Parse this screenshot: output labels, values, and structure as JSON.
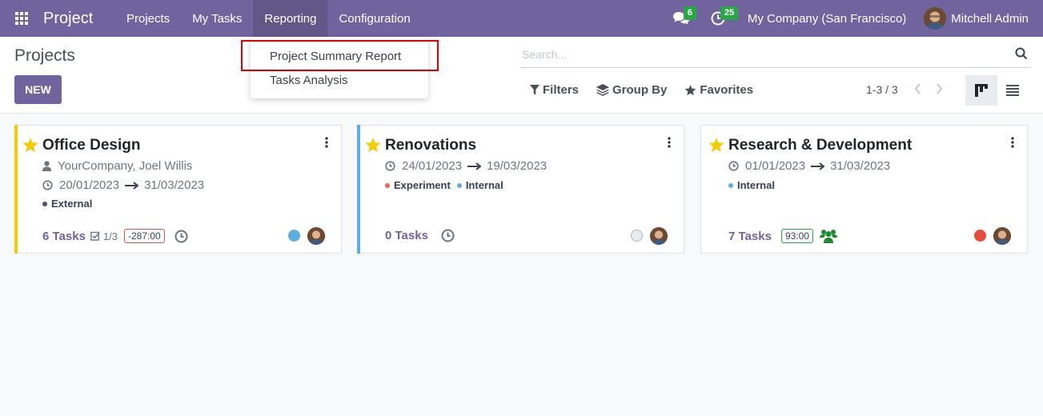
{
  "navbar": {
    "app_name": "Project",
    "menu": [
      "Projects",
      "My Tasks",
      "Reporting",
      "Configuration"
    ],
    "messages_count": "6",
    "activities_count": "25",
    "company": "My Company (San Francisco)",
    "user": "Mitchell Admin"
  },
  "control": {
    "title": "Projects",
    "new_label": "NEW",
    "search_placeholder": "Search...",
    "filters_label": "Filters",
    "group_by_label": "Group By",
    "favorites_label": "Favorites",
    "pager": "1-3 / 3"
  },
  "dropdown": {
    "items": [
      "Project Summary Report",
      "Tasks Analysis"
    ]
  },
  "colors": {
    "brand": "#71639e",
    "favorite_star": "#f3cc00",
    "badge": "#28a745"
  },
  "cards": [
    {
      "title": "Office Design",
      "customer": "YourCompany, Joel Willis",
      "date_start": "20/01/2023",
      "date_end": "31/03/2023",
      "tags": [
        {
          "name": "External",
          "color": "#4a5363"
        }
      ],
      "tasks": "6 Tasks",
      "milestones": "1/3",
      "hours": "-287:00",
      "stripe_color": "#f3cc00",
      "status_color": "#5dade2"
    },
    {
      "title": "Renovations",
      "date_start": "24/01/2023",
      "date_end": "19/03/2023",
      "tags": [
        {
          "name": "Experiment",
          "color": "#f06050"
        },
        {
          "name": "Internal",
          "color": "#5dade2"
        }
      ],
      "tasks": "0 Tasks",
      "stripe_color": "#5dade2",
      "status_color": "#e9ecef"
    },
    {
      "title": "Research & Development",
      "date_start": "01/01/2023",
      "date_end": "31/03/2023",
      "tags": [
        {
          "name": "Internal",
          "color": "#5dade2"
        }
      ],
      "tasks": "7 Tasks",
      "hours": "93:00",
      "status_color": "#e74c3c"
    }
  ]
}
